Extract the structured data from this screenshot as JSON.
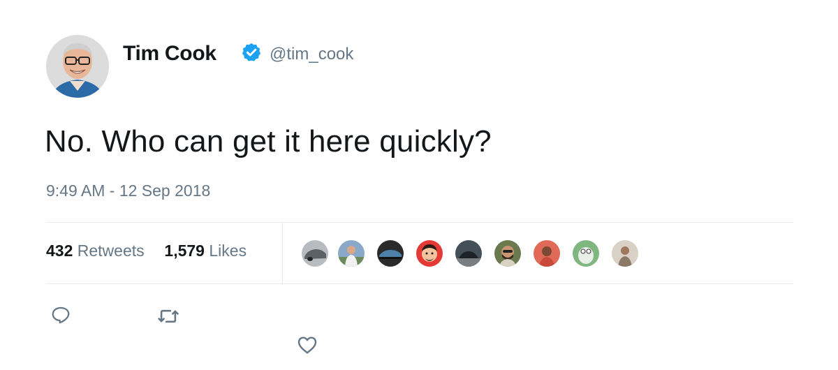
{
  "tweet": {
    "author": {
      "name": "Tim Cook",
      "handle": "@tim_cook",
      "verified": true,
      "avatar_icon": "tim-cook-avatar"
    },
    "text": "No. Who can get it here quickly?",
    "timestamp": "9:49 AM - 12 Sep 2018",
    "stats": {
      "retweets_count": "432",
      "retweets_label": "Retweets",
      "likes_count": "1,579",
      "likes_label": "Likes"
    },
    "liker_avatars": [
      {
        "icon": "car-avatar",
        "bg": "#b8bcc0"
      },
      {
        "icon": "person-outdoor-avatar",
        "bg": "#8aa9c9"
      },
      {
        "icon": "car-dark-avatar",
        "bg": "#2a2a2a"
      },
      {
        "icon": "memoji-avatar",
        "bg": "#e53935"
      },
      {
        "icon": "car-street-avatar",
        "bg": "#445058"
      },
      {
        "icon": "person-beard-avatar",
        "bg": "#6b7a4e"
      },
      {
        "icon": "person-red-avatar",
        "bg": "#e06a57"
      },
      {
        "icon": "kermit-avatar",
        "bg": "#7fb77e"
      },
      {
        "icon": "person-light-avatar",
        "bg": "#d9d0c6"
      }
    ],
    "actions": {
      "reply_icon": "reply-icon",
      "retweet_icon": "retweet-icon",
      "like_icon": "heart-icon"
    },
    "colors": {
      "verified": "#1da1f2",
      "secondary_text": "#657786",
      "divider": "#e6ecf0"
    }
  }
}
